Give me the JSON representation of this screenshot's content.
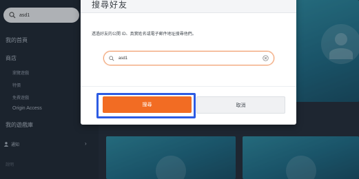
{
  "sidebar": {
    "search_value": "asd1",
    "items": {
      "my_home": "我的首頁",
      "store": "商店",
      "browse_games": "瀏覽遊戲",
      "deals": "特價",
      "free_games": "免費遊戲",
      "origin_access": "Origin Access",
      "my_library": "我的遊戲庫",
      "friends": "通知",
      "bottom": "說明"
    }
  },
  "modal": {
    "title": "搜尋好友",
    "description": "透過好友的公開 ID、真實姓名或電子郵件地址搜尋他們。",
    "search_value": "asd1",
    "search_button": "搜尋",
    "cancel_button": "取消"
  },
  "colors": {
    "accent": "#f26c23",
    "focus_ring": "#2d5be3",
    "sidebar_bg": "#1e2733",
    "tile": "#1f7590"
  }
}
